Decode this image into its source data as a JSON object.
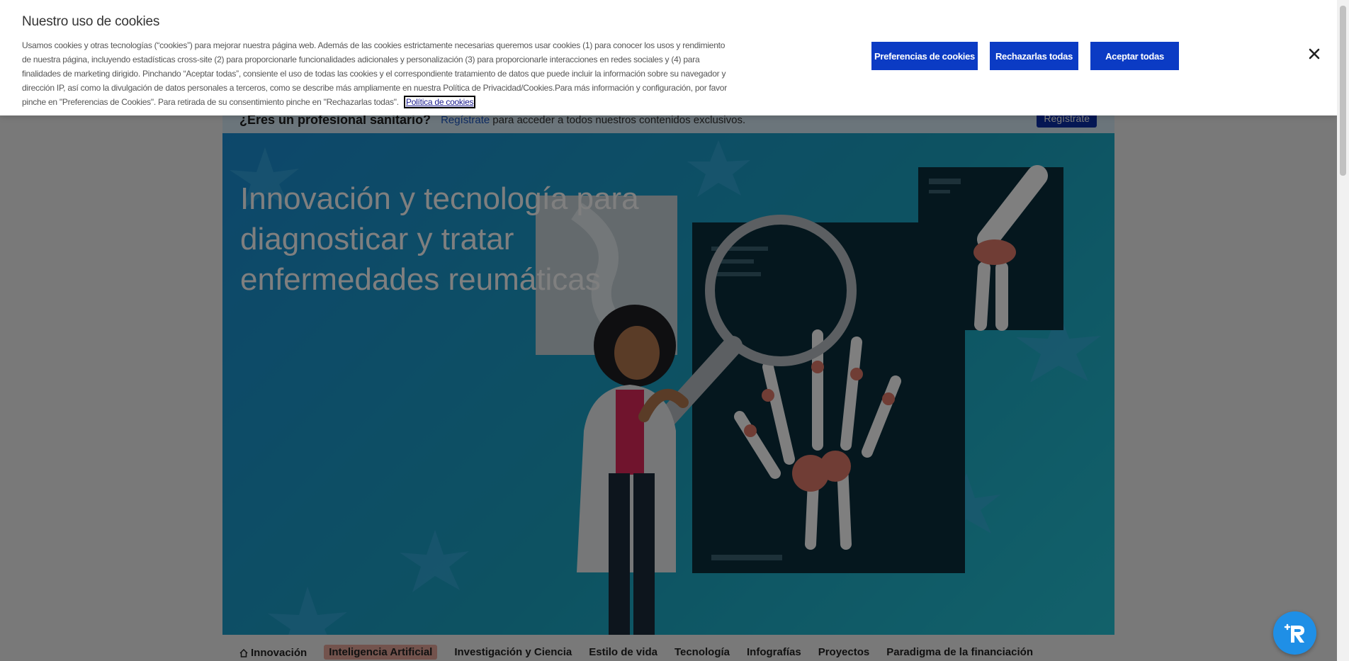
{
  "cookie_banner": {
    "title": "Nuestro uso de cookies",
    "body": "Usamos cookies y otras tecnologías (“cookies”) para mejorar nuestra página web. Además de las cookies estrictamente necesarias queremos usar cookies (1) para conocer los usos y rendimiento de nuestra página, incluyendo estadísticas cross-site (2) para proporcionarle funcionalidades adicionales y personalización (3) para proporcionarle interacciones en redes sociales y (4) para finalidades de marketing dirigido. Pinchando “Aceptar todas”, consiente el uso de todas las cookies y el correspondiente tratamiento de datos que puede incluir la información sobre su navegador y dirección IP, así como la divulgación de datos personales a terceros, como se describe más ampliamente en nuestra Política de Privacidad/Cookies.Para más información y configuración, por favor pinche en \"Preferencias de Cookies\". Para retirada de su consentimiento pinche en \"Rechazarlas todas\".",
    "policy_link": "Política de cookies",
    "buttons": {
      "preferences": "Preferencias de cookies",
      "reject": "Rechazarlas todas",
      "accept": "Aceptar todas"
    },
    "close_icon": "close-icon"
  },
  "register_bar": {
    "question": "¿Eres un profesional sanitario?",
    "link": "Regístrate",
    "text": "para acceder a todos nuestros contenidos exclusivos.",
    "button": "Regístrate"
  },
  "hero": {
    "title": "Innovación y tecnología para diagnosticar y tratar enfermedades reumáticas"
  },
  "nav": {
    "items": [
      "Innovación",
      "Inteligencia Artificial",
      "Investigación y Ciencia",
      "Estilo de vida",
      "Tecnología",
      "Infografías",
      "Proyectos",
      "Paradigma de la financiación"
    ],
    "active_index": 1,
    "home_icon": "home-icon"
  },
  "chat_icon": "chatbot-icon",
  "colors": {
    "button_blue": "#0b3bc4",
    "hero_blue": "#1b8fd6",
    "active_nav": "#e6a79a",
    "fab_blue": "#1f8fe6"
  }
}
